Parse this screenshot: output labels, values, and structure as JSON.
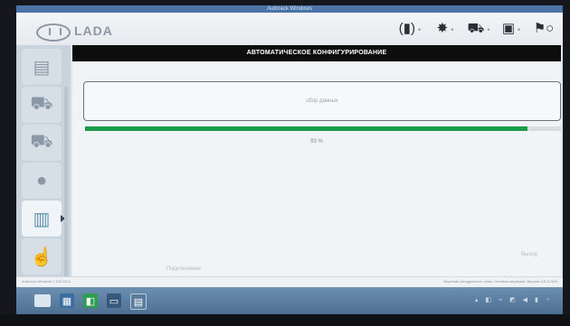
{
  "window": {
    "title": "Autorack Windows"
  },
  "header": {
    "brand": "LADA",
    "icons": [
      "device-status-icon",
      "gear-icon",
      "car-connection-icon",
      "message-icon",
      "run-icon"
    ]
  },
  "sidebar": {
    "items": [
      {
        "icon": "car-list-icon"
      },
      {
        "icon": "car-add-icon"
      },
      {
        "icon": "car-diagnostic-icon"
      },
      {
        "icon": "gauge-icon"
      },
      {
        "icon": "ecu-config-icon",
        "active": true
      },
      {
        "icon": "touch-icon"
      },
      {
        "icon": "antenna-icon"
      }
    ]
  },
  "panel": {
    "title": "АВТОМАТИЧЕСКОЕ КОНФИГУРИРОВАНИЕ",
    "status_text": "сбор данных",
    "progress_percent": 93,
    "progress_label": "93 %"
  },
  "buttons": {
    "left": "Подключение",
    "right": "Выход"
  },
  "statusbar": {
    "left": "Autorack Windows 2.100.5112",
    "right": "Лицензия Автодиагност плюс. Сетевая лицензия. Версия 101.5 HWI"
  },
  "taskbar": {
    "tray_text": "▴ ◧ ⌁ ◩ ◀ ▮ ◔"
  },
  "colors": {
    "progress": "#1a9a4b",
    "title_bg": "#0d0d0d",
    "taskbar": "#4c6f93"
  }
}
